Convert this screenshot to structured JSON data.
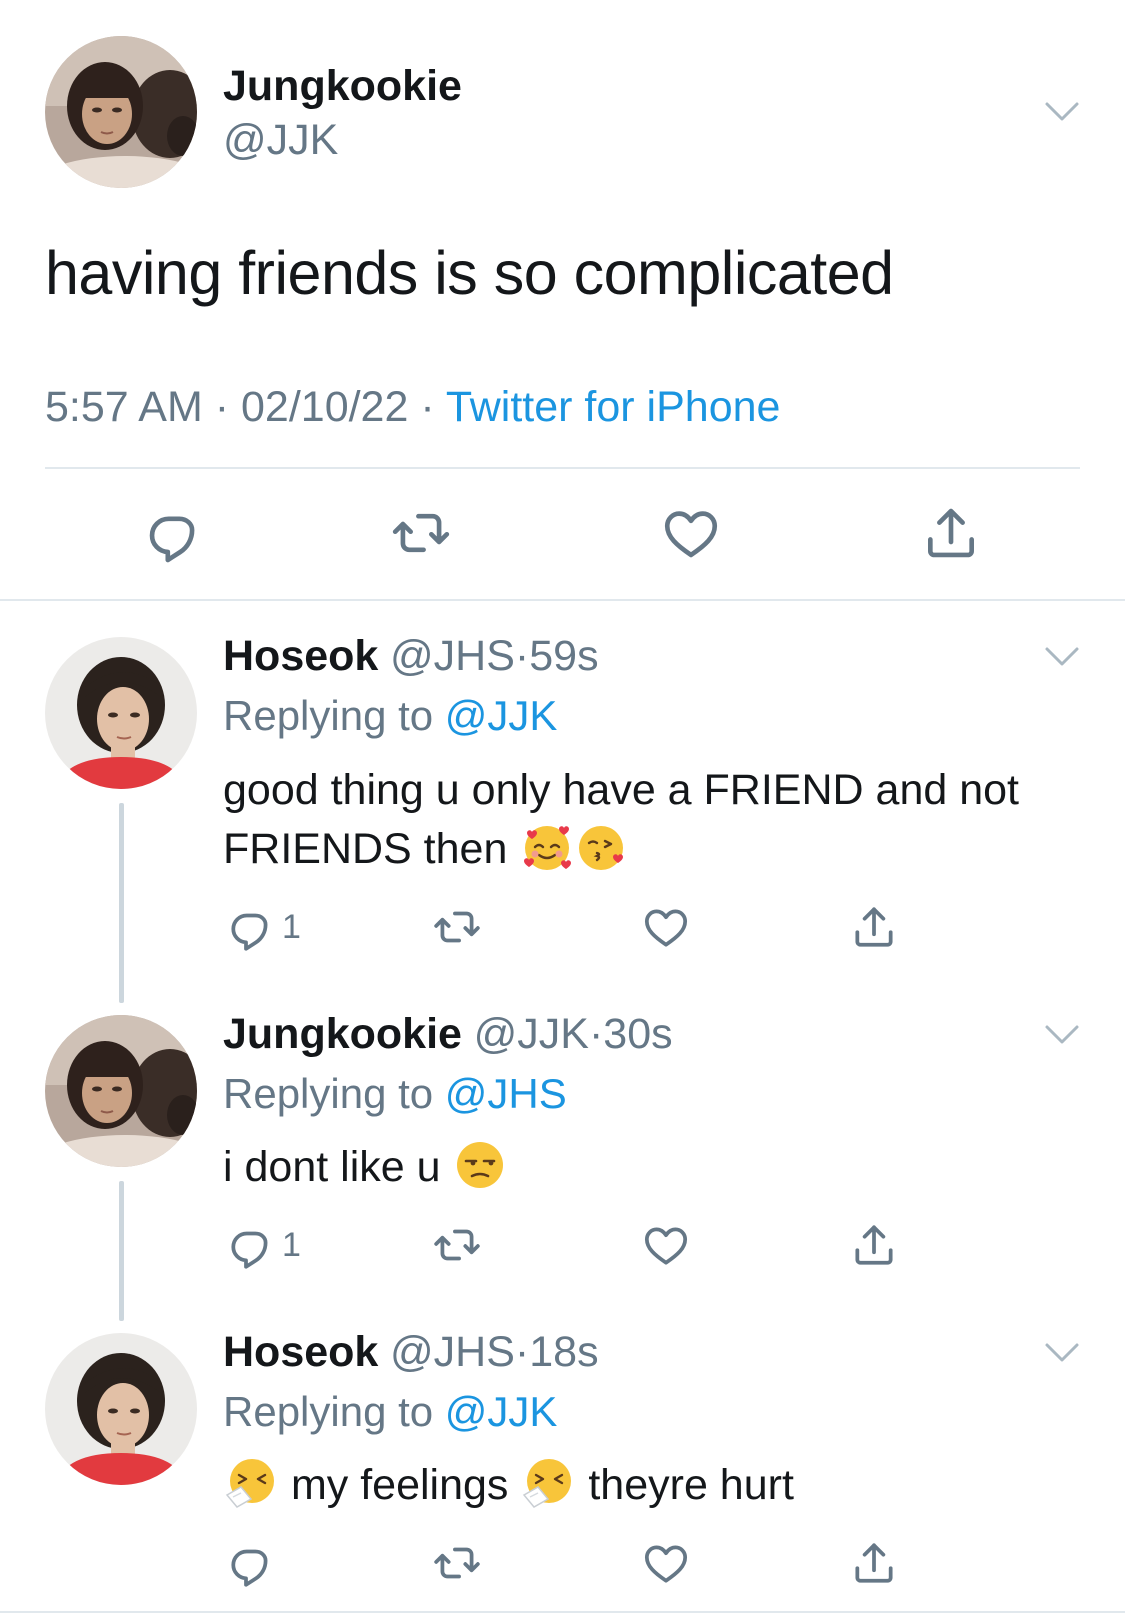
{
  "colors": {
    "text": "#14171a",
    "muted": "#657786",
    "link": "#1b95e0",
    "divider": "#e1e8ed"
  },
  "main_tweet": {
    "display_name": "Jungkookie",
    "handle": "@JJK",
    "text": "having friends is so complicated",
    "time": "5:57 AM",
    "date": "02/10/22",
    "separator": "·",
    "source": "Twitter for iPhone",
    "actions": [
      "reply-icon",
      "retweet-icon",
      "like-icon",
      "share-icon"
    ]
  },
  "replies": [
    {
      "display_name": "Hoseok",
      "handle": "@JHS",
      "age": "59s",
      "replying_prefix": "Replying to",
      "replying_to": "@JJK",
      "text_line1": "good thing u only have a FRIEND and not",
      "text_line2": "FRIENDS then",
      "emojis": [
        "smiling-face-with-hearts-emoji",
        "face-blowing-kiss-emoji"
      ],
      "reply_count": "1"
    },
    {
      "display_name": "Jungkookie",
      "handle": "@JJK",
      "age": "30s",
      "replying_prefix": "Replying to",
      "replying_to": "@JHS",
      "text_line1": "i dont like u",
      "emojis": [
        "unamused-face-emoji"
      ],
      "reply_count": "1"
    },
    {
      "display_name": "Hoseok",
      "handle": "@JHS",
      "age": "18s",
      "replying_prefix": "Replying to",
      "replying_to": "@JJK",
      "text_part1": "my feelings",
      "text_part2": "theyre hurt",
      "emojis": [
        "sneezing-face-emoji",
        "sneezing-face-emoji"
      ],
      "reply_count": ""
    }
  ]
}
